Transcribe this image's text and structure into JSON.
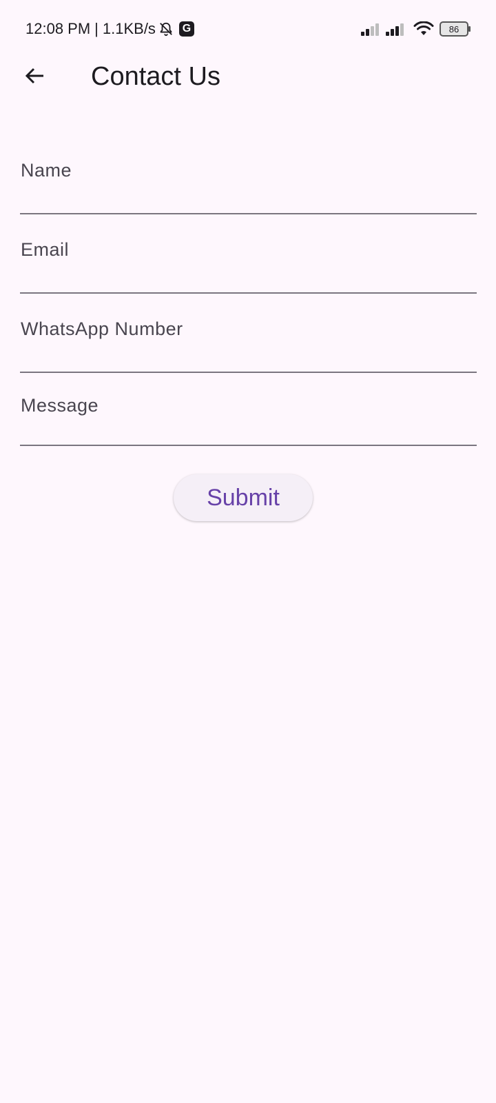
{
  "status_bar": {
    "time": "12:08 PM",
    "separator": "|",
    "network_speed": "1.1KB/s",
    "mute_icon": "bell-off-icon",
    "g_badge": "G",
    "signal_icons": [
      "signal-sim1-icon",
      "signal-sim2-icon"
    ],
    "wifi_icon": "wifi-icon",
    "battery_level": "86"
  },
  "app_bar": {
    "back_icon": "arrow-left-icon",
    "title": "Contact Us"
  },
  "form": {
    "fields": [
      {
        "label": "Name",
        "value": ""
      },
      {
        "label": "Email",
        "value": ""
      },
      {
        "label": "WhatsApp Number",
        "value": ""
      },
      {
        "label": "Message",
        "value": ""
      }
    ],
    "submit_label": "Submit"
  },
  "colors": {
    "background": "#fef7fd",
    "accent": "#6741a8",
    "label": "#49454f",
    "underline": "#7a757f",
    "button_bg": "#f5eff7"
  }
}
